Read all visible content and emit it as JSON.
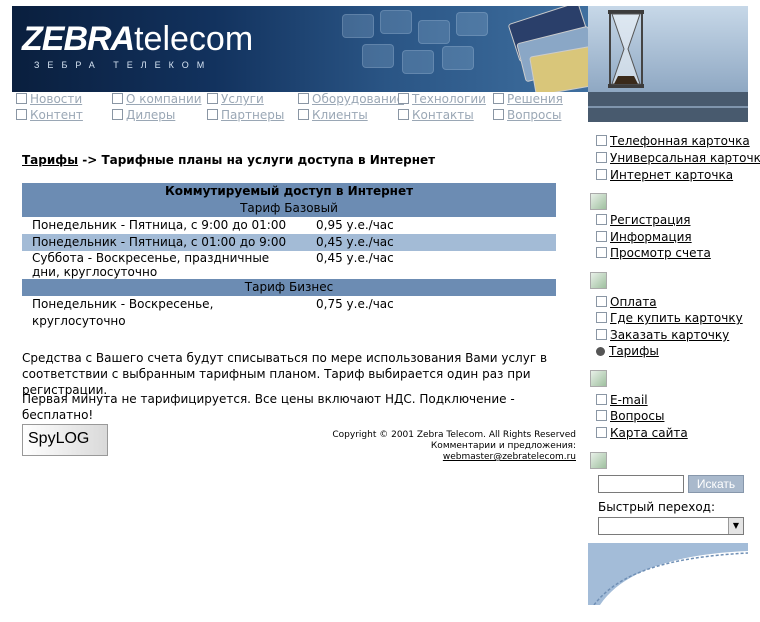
{
  "header": {
    "logo_main": "ZEBRA",
    "logo_suffix": "telecom",
    "logo_subtitle": "ЗЕБРА ТЕЛЕКОМ"
  },
  "nav": {
    "row1": [
      "Новости",
      "О компании",
      "Услуги",
      "Оборудование",
      "Технологии",
      "Решения"
    ],
    "row2": [
      "Контент",
      "Дилеры",
      "Партнеры",
      "Клиенты",
      "Контакты",
      "Вопросы"
    ]
  },
  "breadcrumb": {
    "link": "Тарифы",
    "rest": " -> Тарифные планы на услуги доступа в Интернет"
  },
  "table": {
    "title": "Коммутируемый доступ в Интернет",
    "groups": [
      {
        "name": "Тариф Базовый",
        "rows": [
          {
            "period": "Понедельник - Пятница, с 9:00 до 01:00",
            "price": "0,95 у.е./час"
          },
          {
            "period": "Понедельник - Пятница, с 01:00 до 9:00",
            "price": "0,45 у.е./час"
          },
          {
            "period": "Суббота - Воскресенье, праздничные дни, круглосуточно",
            "price": "0,45 у.е./час"
          }
        ]
      },
      {
        "name": "Тариф Бизнес",
        "rows": [
          {
            "period": "Понедельник - Воскресенье, круглосуточно",
            "price": "0,75 у.е./час"
          }
        ]
      }
    ]
  },
  "paragraphs": {
    "p1": "Средства с Вашего счета будут списываться по мере использования Вами услуг в соответствии с выбранным тарифным планом. Тариф выбирается один раз при регистрации.",
    "p2": "Первая минута не тарифицируется. Все цены включают НДС. Подключение - бесплатно!"
  },
  "footer": {
    "copyright": "Copyright © 2001 Zebra Telecom. All Rights Reserved",
    "feedback_label": "Комментарии и предложения: ",
    "email": "webmaster@zebratelecom.ru",
    "counter_logo": "SpyLOG"
  },
  "sidebar": {
    "group1": [
      "Телефонная карточка",
      "Универсальная карточка",
      "Интернет карточка"
    ],
    "group2": [
      "Регистрация",
      "Информация",
      "Просмотр счета"
    ],
    "group3": [
      "Оплата",
      "Где купить карточку",
      "Заказать карточку",
      "Тарифы"
    ],
    "group4": [
      "E-mail",
      "Вопросы",
      "Карта сайта"
    ],
    "search_button": "Искать",
    "search_value": "",
    "quick_jump_label": "Быстрый переход:",
    "quick_jump_value": ""
  },
  "colors": {
    "table_header": "#6c8cb3",
    "row_highlight": "#a3bbd6",
    "nav_link": "#9aa7b5"
  }
}
